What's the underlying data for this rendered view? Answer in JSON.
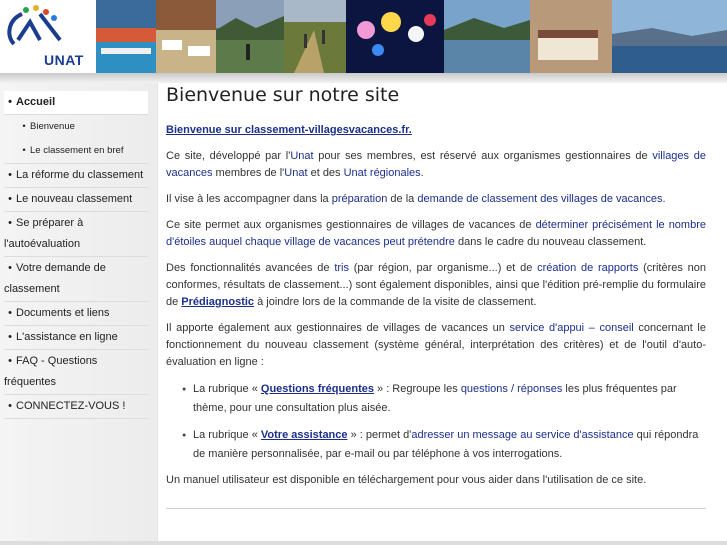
{
  "logo": {
    "text": "UNAT"
  },
  "sidebar": {
    "items": [
      {
        "label": "Accueil",
        "active": true
      },
      {
        "label": "Bienvenue",
        "sub": true
      },
      {
        "label": "Le classement en bref",
        "sub": true
      },
      {
        "label": "La réforme du classement"
      },
      {
        "label": "Le nouveau classement"
      },
      {
        "label": "Se préparer à l'autoévaluation"
      },
      {
        "label": "Votre demande de classement"
      },
      {
        "label": "Documents et liens"
      },
      {
        "label": "L'assistance en ligne"
      },
      {
        "label": "FAQ - Questions fréquentes"
      },
      {
        "label": "CONNECTEZ-VOUS !"
      }
    ]
  },
  "main": {
    "title": "Bienvenue sur notre site",
    "intro_link": "Bienvenue sur classement-villagesvacances.fr.",
    "p1": {
      "t1": "Ce site, développé par l'",
      "l1": "Unat",
      "t2": " pour ses membres, est réservé aux organismes gestionnaires de ",
      "l2": "villages de vacances",
      "t3": " membres de l'",
      "l3": "Unat",
      "t4": " et des ",
      "l4": "Unat régionales",
      "t5": "."
    },
    "p2": {
      "t1": "Il vise à les accompagner dans la ",
      "l1": "préparation",
      "t2": " de la ",
      "l2": "demande de classement des villages de vacances",
      "t3": "."
    },
    "p3": {
      "t1": "Ce site permet aux organismes gestionnaires de villages de vacances de ",
      "l1": "déterminer précisément le nombre d'étoiles auquel chaque village de vacances peut prétendre",
      "t2": " dans le cadre du nouveau classement."
    },
    "p4": {
      "t1": "Des fonctionnalités avancées de ",
      "l1": "tris",
      "t2": " (par région, par organisme...) et de ",
      "l2": "création de rapports",
      "t3": " (critères non conformes, résultats de classement...) sont également disponibles, ainsi que l'édition pré-remplie du formulaire de ",
      "l3": "Prédiagnostic",
      "t4": " à joindre lors de la commande de la visite de classement."
    },
    "p5": {
      "t1": "Il apporte également aux gestionnaires de villages de vacances un ",
      "l1": "service d'appui – conseil",
      "t2": " concernant le fonctionnement du nouveau classement (système général, interprétation des critères) et de l'outil d'auto-évaluation en ligne :"
    },
    "b1": {
      "t1": "La rubrique « ",
      "l1": "Questions fréquentes",
      "t2": " » : Regroupe les ",
      "l2": "questions / réponses",
      "t3": " les plus fréquentes par thème, pour une consultation plus aisée."
    },
    "b2": {
      "t1": "La rubrique « ",
      "l1": "Votre assistance",
      "t2": " » :  permet d'",
      "l2": "adresser un message au service d'assistance",
      "t3": " qui répondra de manière personnalisée, par e-mail ou par téléphone à vos interrogations."
    },
    "p6": "Un manuel utilisateur est disponible en téléchargement pour vous aider dans l'utilisation de ce site."
  }
}
